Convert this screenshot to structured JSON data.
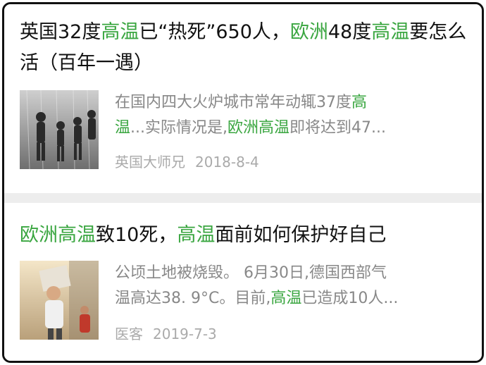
{
  "articles": [
    {
      "title_parts": [
        "英国32度",
        "高温",
        "已“热死”650人，",
        "欧洲",
        "48度",
        "高温",
        "要怎么活（百年一遇）"
      ],
      "snippet_line1": [
        "在国内四大火炉城市常年动辄37度",
        "高"
      ],
      "snippet_line2": [
        "温",
        "...实际情况是,",
        "欧洲高温",
        "即将达到47..."
      ],
      "source": "英国大师兄",
      "date": "2018-8-4",
      "thumb_icon": "children-fountain-photo"
    },
    {
      "title_parts": [
        "欧洲高温",
        "致10死，",
        "高温",
        "面前如何保护好自己"
      ],
      "snippet_line1": [
        "公顷土地被烧毁。 6月30日,德国西部气"
      ],
      "snippet_line2": [
        "温高达38. 9°C。目前,",
        "高温",
        "已造成10人..."
      ],
      "source": "医客",
      "date": "2019-7-3",
      "thumb_icon": "woman-shading-sun-photo"
    }
  ],
  "colors": {
    "highlight": "#3aa640",
    "border": "#111111",
    "meta": "#aaaaaa",
    "snippet": "#888888"
  }
}
